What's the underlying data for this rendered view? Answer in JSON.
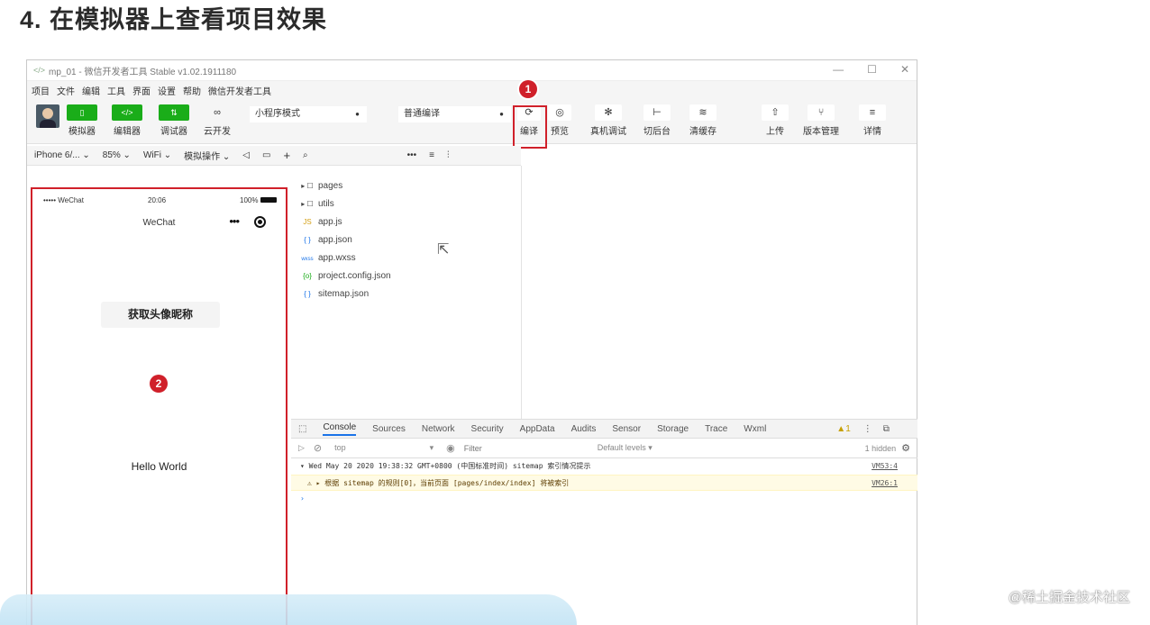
{
  "heading": "4. 在模拟器上查看项目效果",
  "window": {
    "title": "mp_01 - 微信开发者工具 Stable v1.02.1911180",
    "controls": [
      "—",
      "☐",
      "✕"
    ]
  },
  "menu": [
    "项目",
    "文件",
    "编辑",
    "工具",
    "界面",
    "设置",
    "帮助",
    "微信开发者工具"
  ],
  "toolbar": {
    "simulator": "模拟器",
    "editor": "编辑器",
    "debugger": "调试器",
    "cloud": "云开发",
    "mode": "小程序模式",
    "compile_mode": "普通编译",
    "compile": "编译",
    "preview": "预览",
    "remote_debug": "真机调试",
    "background": "切后台",
    "clear_cache": "清缓存",
    "upload": "上传",
    "version": "版本管理",
    "detail": "详情"
  },
  "subbar": {
    "device": "iPhone 6/...",
    "zoom": "85%",
    "network": "WiFi",
    "sim_ops": "模拟操作"
  },
  "badges": {
    "one": "1",
    "two": "2"
  },
  "phone": {
    "carrier": "••••• WeChat",
    "time": "20:06",
    "battery": "100%",
    "nav_title": "WeChat",
    "get_avatar": "获取头像昵称",
    "hello": "Hello World"
  },
  "files": [
    {
      "icon": "▸ ☐",
      "name": "pages"
    },
    {
      "icon": "▸ ☐",
      "name": "utils"
    },
    {
      "icon": "JS",
      "name": "app.js"
    },
    {
      "icon": "{ }",
      "name": "app.json"
    },
    {
      "icon": "wxss",
      "name": "app.wxss"
    },
    {
      "icon": "{o}",
      "name": "project.config.json"
    },
    {
      "icon": "{ }",
      "name": "sitemap.json"
    }
  ],
  "devtools": {
    "tabs": [
      "Console",
      "Sources",
      "Network",
      "Security",
      "AppData",
      "Audits",
      "Sensor",
      "Storage",
      "Trace",
      "Wxml"
    ],
    "warn_count": "1",
    "context": "top",
    "filter_placeholder": "Filter",
    "levels": "Default levels ▾",
    "hidden": "1 hidden",
    "log1": "▾ Wed May 20 2020 19:38:32 GMT+0800 (中国标准时间) sitemap 索引情况提示",
    "log1_src": "VM53:4",
    "log2": "⚠ ▸ 根据 sitemap 的规则[0]，当前页面 [pages/index/index] 将被索引",
    "log2_src": "VM26:1",
    "prompt": "›"
  },
  "watermark": "@稀土掘金技术社区"
}
